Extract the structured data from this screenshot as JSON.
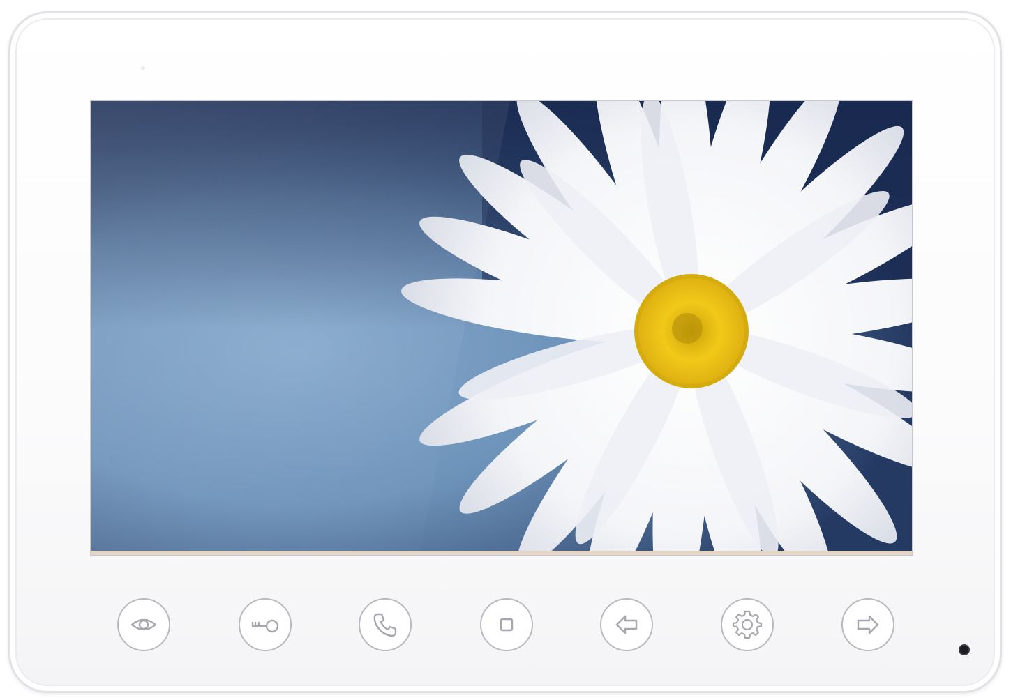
{
  "device": {
    "type": "video-intercom-monitor",
    "colors": {
      "body": "#ffffff",
      "button_ring": "#b9b9bf",
      "icon": "#a6a6ad",
      "screen_bg": "#6f8fae",
      "flower_center": "#f2c418",
      "led": "#1c1c22"
    }
  },
  "screen": {
    "wallpaper": "white-daisy-on-blue"
  },
  "buttons": [
    {
      "name": "monitor",
      "icon": "eye-icon"
    },
    {
      "name": "unlock",
      "icon": "key-icon"
    },
    {
      "name": "talk",
      "icon": "phone-icon"
    },
    {
      "name": "stop",
      "icon": "square-icon"
    },
    {
      "name": "back",
      "icon": "arrow-left-icon"
    },
    {
      "name": "settings",
      "icon": "gear-icon"
    },
    {
      "name": "next",
      "icon": "arrow-right-icon"
    }
  ],
  "status_led": {
    "state": "off"
  }
}
